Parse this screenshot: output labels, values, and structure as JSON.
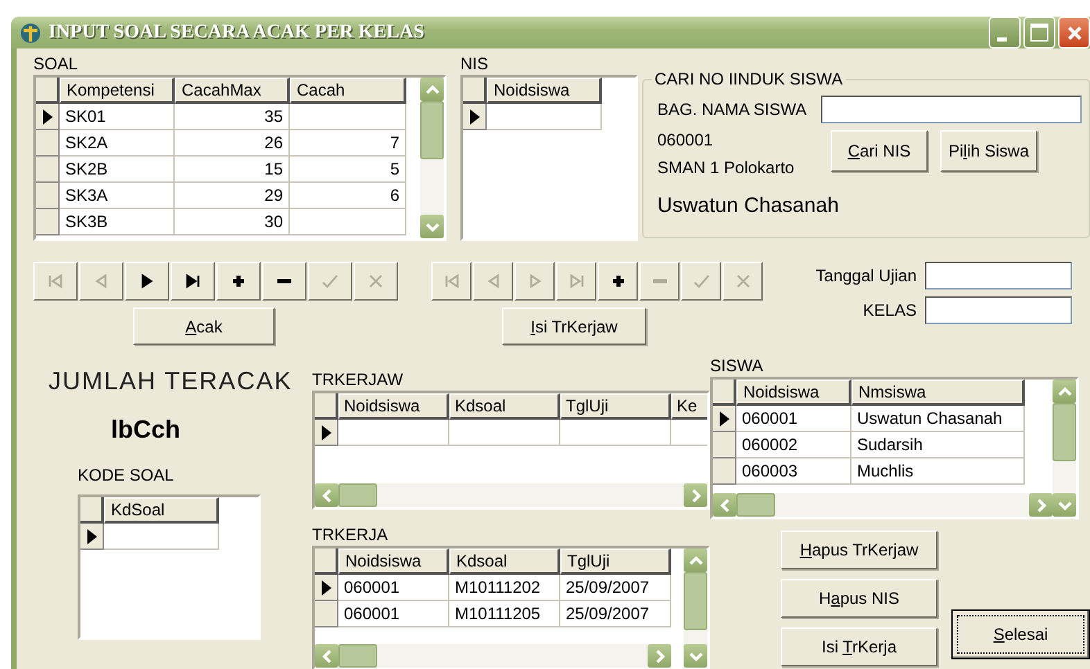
{
  "window": {
    "title": "INPUT SOAL SECARA ACAK PER KELAS"
  },
  "soal": {
    "label": "SOAL",
    "columns": [
      {
        "title": "Kompetensi"
      },
      {
        "title": "CacahMax"
      },
      {
        "title": "Cacah"
      }
    ],
    "rows": [
      {
        "selected": true,
        "cells": [
          "SK01",
          "35"
        ]
      },
      {
        "selected": false,
        "cells": [
          "SK2A",
          "26",
          "7"
        ]
      },
      {
        "selected": false,
        "cells": [
          "SK2B",
          "15",
          "5"
        ]
      },
      {
        "selected": false,
        "cells": [
          "SK3A",
          "29",
          "6"
        ]
      },
      {
        "selected": false,
        "cells": [
          "SK3B",
          "30"
        ]
      }
    ]
  },
  "nis": {
    "label": "NIS",
    "columns": [
      {
        "title": "Noidsiswa"
      }
    ],
    "rows": [
      {
        "selected": true
      }
    ]
  },
  "search_group": {
    "title": "CARI NO IINDUK SISWA",
    "field_label": "BAG. NAMA SISWA",
    "nis": "060001",
    "school": "SMAN 1 Polokarto",
    "name": "Uswatun Chasanah",
    "buttons": [
      {
        "key": "C",
        "post": "ari NIS"
      },
      {
        "pre": "Pi",
        "key": "l",
        "post": "ih Siswa"
      }
    ]
  },
  "navigators": [
    {
      "buttons": [
        {
          "kind": "first",
          "disabled": true
        },
        {
          "kind": "prior",
          "disabled": true
        },
        {
          "kind": "next",
          "disabled": false
        },
        {
          "kind": "last",
          "disabled": false
        },
        {
          "kind": "insert",
          "disabled": false
        },
        {
          "kind": "delete",
          "disabled": false
        },
        {
          "kind": "post",
          "disabled": true
        },
        {
          "kind": "cancel",
          "disabled": true
        }
      ]
    },
    {
      "buttons": [
        {
          "kind": "first",
          "disabled": true
        },
        {
          "kind": "prior",
          "disabled": true
        },
        {
          "kind": "next",
          "disabled": true
        },
        {
          "kind": "last",
          "disabled": true
        },
        {
          "kind": "insert",
          "disabled": false
        },
        {
          "kind": "delete",
          "disabled": true
        },
        {
          "kind": "post",
          "disabled": true
        },
        {
          "kind": "cancel",
          "disabled": true
        }
      ]
    }
  ],
  "acak_button": {
    "key": "A",
    "post": "cak"
  },
  "isi_trkerjaw_button": {
    "key": "I",
    "post": "si TrKerjaw"
  },
  "tanggal_ujian": {
    "label": "Tanggal Ujian"
  },
  "kelas": {
    "label": "KELAS"
  },
  "jumlah_teracak": {
    "label": "JUMLAH TERACAK",
    "value": "lbCch"
  },
  "kode_soal": {
    "label": "KODE SOAL",
    "columns": [
      {
        "title": "KdSoal"
      }
    ],
    "rows": [
      {
        "selected": true
      }
    ]
  },
  "trkerjaw": {
    "label": "TRKERJAW",
    "columns": [
      {
        "title": "Noidsiswa"
      },
      {
        "title": "Kdsoal"
      },
      {
        "title": "TglUji"
      },
      {
        "title": "Ke"
      }
    ],
    "rows": [
      {
        "selected": true
      }
    ]
  },
  "trkerja": {
    "label": "TRKERJA",
    "columns": [
      {
        "title": "Noidsiswa"
      },
      {
        "title": "Kdsoal"
      },
      {
        "title": "TglUji"
      }
    ],
    "rows": [
      {
        "selected": true,
        "cells": [
          "060001",
          "M10111202",
          "25/09/2007"
        ]
      },
      {
        "selected": false,
        "cells": [
          "060001",
          "M10111205",
          "25/09/2007"
        ]
      }
    ]
  },
  "siswa": {
    "label": "SISWA",
    "columns": [
      {
        "title": "Noidsiswa"
      },
      {
        "title": "Nmsiswa"
      }
    ],
    "rows": [
      {
        "selected": true,
        "cells": [
          "060001",
          "Uswatun Chasanah"
        ]
      },
      {
        "selected": false,
        "cells": [
          "060002",
          "Sudarsih"
        ]
      },
      {
        "selected": false,
        "cells": [
          "060003",
          "Muchlis"
        ]
      }
    ]
  },
  "action_buttons": [
    {
      "key": "H",
      "post": "apus TrKerjaw"
    },
    {
      "pre": "H",
      "key": "a",
      "post": "pus NIS"
    },
    {
      "pre": "Isi ",
      "key": "T",
      "post": "rKerja"
    }
  ],
  "selesai_button": {
    "key": "S",
    "post": "elesai",
    "focused": true
  }
}
